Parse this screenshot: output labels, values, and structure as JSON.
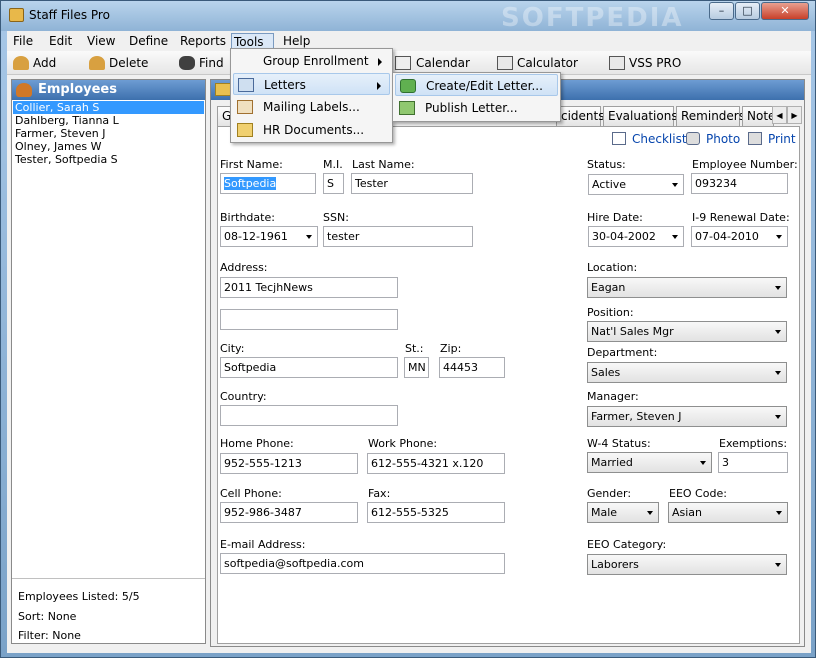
{
  "window": {
    "title": "Staff Files Pro",
    "watermark": "SOFTPEDIA",
    "minimize": "–",
    "maximize": "□",
    "close": "✕"
  },
  "menu": {
    "file": "File",
    "edit": "Edit",
    "view": "View",
    "define": "Define",
    "reports": "Reports",
    "tools": "Tools",
    "help": "Help"
  },
  "toolbar": {
    "add": "Add",
    "delete": "Delete",
    "find": "Find",
    "calendar": "Calendar",
    "calculator": "Calculator",
    "vss": "VSS PRO"
  },
  "tools_menu": {
    "items": [
      "Group Enrollment",
      "Letters",
      "Mailing Labels...",
      "HR Documents..."
    ]
  },
  "letters_menu": {
    "items": [
      "Create/Edit Letter...",
      "Publish Letter..."
    ]
  },
  "employees": {
    "header": "Employees",
    "list": [
      "Collier, Sarah S",
      "Dahlberg, Tianna L",
      "Farmer, Steven J",
      "Olney, James W",
      "Tester, Softpedia S"
    ],
    "selected_index": 0,
    "listed": "Employees Listed: 5/5",
    "sort": "Sort: None",
    "filter": "Filter: None"
  },
  "tabs": {
    "first": "G",
    "items": [
      "cidents",
      "Evaluations",
      "Reminders",
      "Notes"
    ]
  },
  "actions": {
    "checklist": "Checklist",
    "photo": "Photo",
    "print": "Print"
  },
  "form": {
    "first_name_label": "First Name:",
    "first_name": "Softpedia",
    "mi_label": "M.I.",
    "mi": "S",
    "last_name_label": "Last Name:",
    "last_name": "Tester",
    "birthdate_label": "Birthdate:",
    "birthdate": "08-12-1961",
    "ssn_label": "SSN:",
    "ssn": "tester",
    "address_label": "Address:",
    "address1": "2011 TecjhNews",
    "address2": "",
    "city_label": "City:",
    "city": "Softpedia",
    "state_label": "St.:",
    "state": "MN",
    "zip_label": "Zip:",
    "zip": "44453",
    "country_label": "Country:",
    "country": "",
    "home_phone_label": "Home Phone:",
    "home_phone": "952-555-1213",
    "work_phone_label": "Work Phone:",
    "work_phone": "612-555-4321 x.120",
    "cell_phone_label": "Cell Phone:",
    "cell_phone": "952-986-3487",
    "fax_label": "Fax:",
    "fax": "612-555-5325",
    "email_label": "E-mail Address:",
    "email": "softpedia@softpedia.com",
    "status_label": "Status:",
    "status": "Active",
    "emp_number_label": "Employee Number:",
    "emp_number": "093234",
    "hire_date_label": "Hire Date:",
    "hire_date": "30-04-2002",
    "i9_label": "I-9 Renewal Date:",
    "i9": "07-04-2010",
    "location_label": "Location:",
    "location": "Eagan",
    "position_label": "Position:",
    "position": "Nat'l Sales Mgr",
    "department_label": "Department:",
    "department": "Sales",
    "manager_label": "Manager:",
    "manager": "Farmer, Steven J",
    "w4_label": "W-4 Status:",
    "w4": "Married",
    "exemptions_label": "Exemptions:",
    "exemptions": "3",
    "gender_label": "Gender:",
    "gender": "Male",
    "eeo_code_label": "EEO Code:",
    "eeo_code": "Asian",
    "eeo_category_label": "EEO Category:",
    "eeo_category": "Laborers"
  }
}
